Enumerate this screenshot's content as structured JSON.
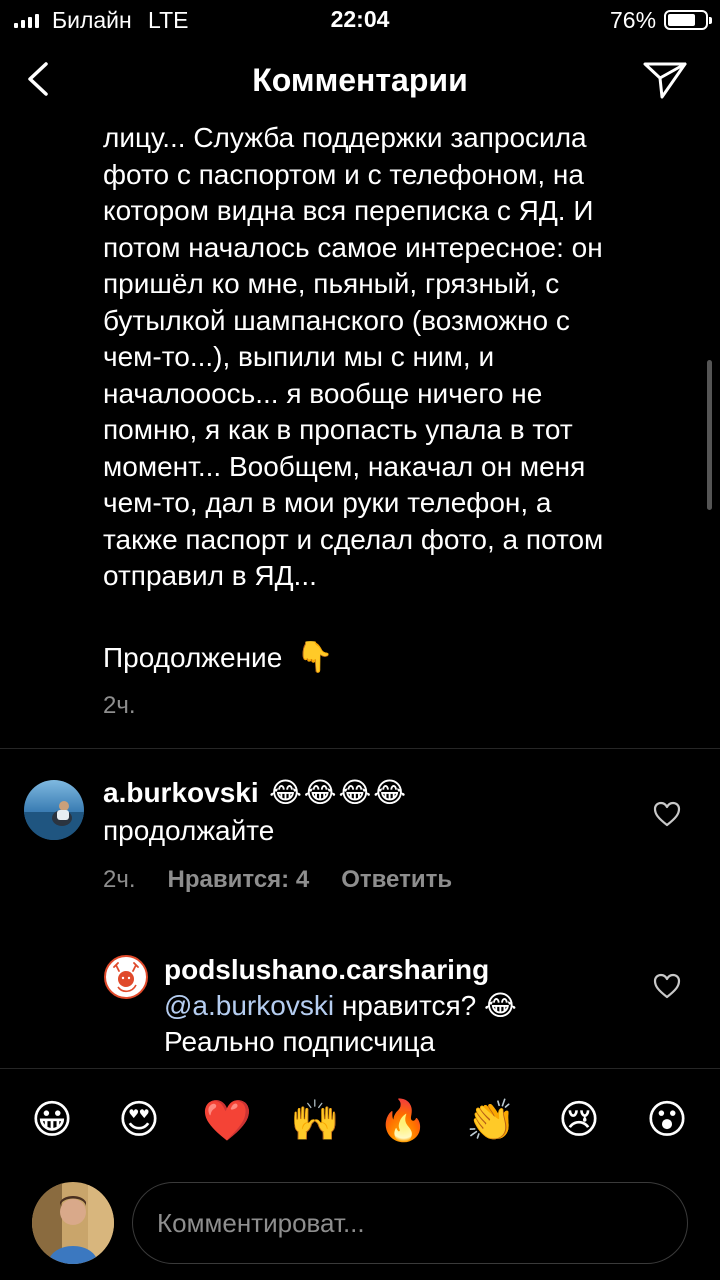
{
  "status_bar": {
    "carrier": "Билайн",
    "network": "LTE",
    "time": "22:04",
    "battery_percent": "76%",
    "battery_level": 0.76
  },
  "header": {
    "title": "Комментарии",
    "back_icon": "chevron-left-icon",
    "send_icon": "paper-plane-icon"
  },
  "post": {
    "lines": [
      "лицу... Служба поддержки запросила",
      "фото с паспортом и с телефоном, на",
      "котором видна вся переписка с ЯД. И",
      "потом началось самое интересное: он",
      "пришёл ко мне, пьяный, грязный, с",
      "бутылкой шампанского (возможно с",
      "чем-то...), выпили мы с ним, и",
      "началooось... я вообще ничего не",
      "помню, я как в пропасть упала в тот",
      "момент... Вообщем, накачал он меня",
      "чем-то, дал в мои руки телефон, а",
      "также паспорт и сделал фото, а потом",
      "отправил в ЯД..."
    ],
    "continuation": "Продолжение",
    "continuation_emoji": "👇",
    "time": "2ч."
  },
  "comments": [
    {
      "username": "a.burkovski",
      "emoji": "😂😂😂😂",
      "text": "продолжайте",
      "time": "2ч.",
      "likes": "Нравится: 4",
      "reply": "Ответить"
    },
    {
      "username": "podslushano.carsharing",
      "mention": "@a.burkovski",
      "text_after_mention": " нравится? 😂",
      "text_line2": "Реально подписчица"
    }
  ],
  "emoji_bar": [
    "😀",
    "😍",
    "❤️",
    "🙌",
    "🔥",
    "👏",
    "😢",
    "😮"
  ],
  "composer": {
    "placeholder": "Комментироват..."
  },
  "colors": {
    "background": "#000000",
    "secondary_text": "#8e8e8e",
    "mention": "#b5cdf0",
    "divider": "#262626"
  }
}
